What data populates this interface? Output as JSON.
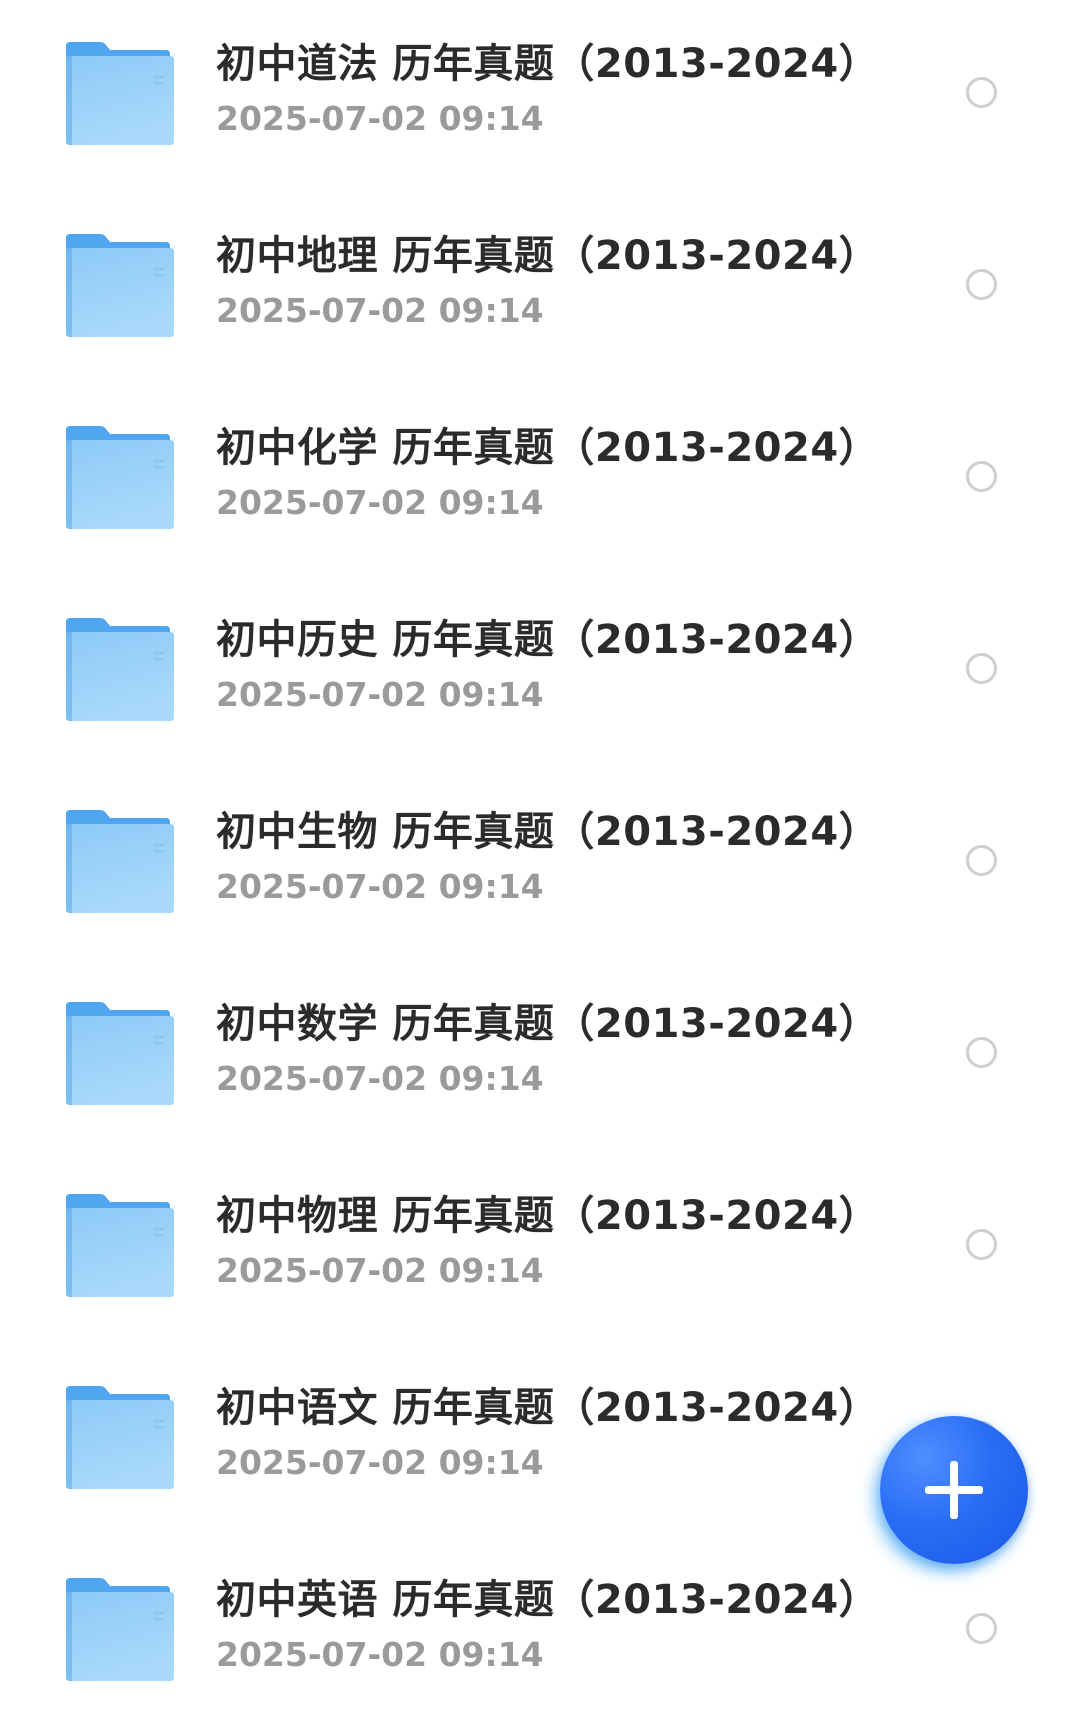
{
  "files": [
    {
      "name": "初中道法 历年真题（2013-2024）",
      "modified": "2025-07-02 09:14",
      "icon": "folder-icon"
    },
    {
      "name": "初中地理 历年真题（2013-2024）",
      "modified": "2025-07-02 09:14",
      "icon": "folder-icon"
    },
    {
      "name": "初中化学 历年真题（2013-2024）",
      "modified": "2025-07-02 09:14",
      "icon": "folder-icon"
    },
    {
      "name": "初中历史 历年真题（2013-2024）",
      "modified": "2025-07-02 09:14",
      "icon": "folder-icon"
    },
    {
      "name": "初中生物 历年真题（2013-2024）",
      "modified": "2025-07-02 09:14",
      "icon": "folder-icon"
    },
    {
      "name": "初中数学 历年真题（2013-2024）",
      "modified": "2025-07-02 09:14",
      "icon": "folder-icon"
    },
    {
      "name": "初中物理 历年真题（2013-2024）",
      "modified": "2025-07-02 09:14",
      "icon": "folder-icon"
    },
    {
      "name": "初中语文 历年真题（2013-2024）",
      "modified": "2025-07-02 09:14",
      "icon": "folder-icon"
    },
    {
      "name": "初中英语 历年真题（2013-2024）",
      "modified": "2025-07-02 09:14",
      "icon": "folder-icon"
    }
  ],
  "fab": {
    "icon": "plus-icon",
    "color": "#2a6df5"
  },
  "colors": {
    "folder": "#6ab4f2",
    "title": "#2b2b2b",
    "time": "#9a9a9a",
    "radio": "#cfcfcf"
  }
}
